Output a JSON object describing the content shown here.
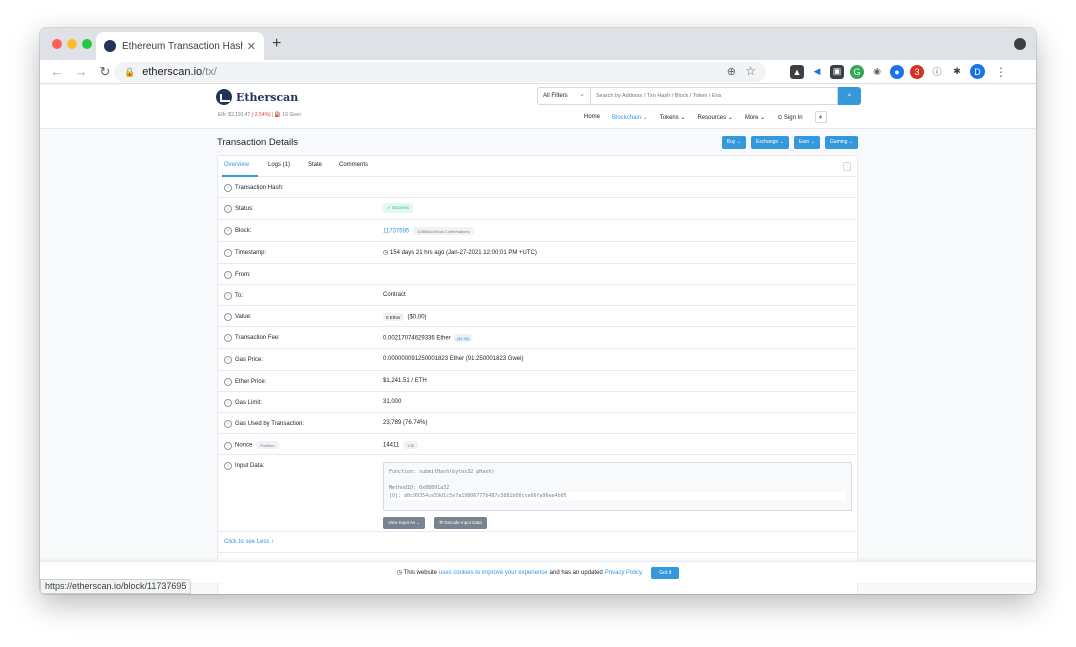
{
  "browser": {
    "tab_title": "Ethereum Transaction Hash (Tx",
    "new_tab": "+",
    "url_host": "etherscan.io",
    "url_path": "/tx/",
    "profile_initial": "D",
    "status_url": "https://etherscan.io/block/11737695"
  },
  "header": {
    "logo_text": "Etherscan",
    "eth_price_label": "Eth: $2,110.47",
    "eth_price_change": "(-2.54%)",
    "gas_label": "|  ⛽ 16 Gwei",
    "filter_label": "All Filters",
    "search_placeholder": "Search by Address / Txn Hash / Block / Token / Ens",
    "nav": [
      "Home",
      "Blockchain ⌄",
      "Tokens ⌄",
      "Resources ⌄",
      "More ⌄",
      "Sign In"
    ]
  },
  "page": {
    "title": "Transaction Details",
    "buttons": [
      "Buy ⌄",
      "Exchange ⌄",
      "Earn ⌄",
      "Gaming ⌄"
    ],
    "tabs": [
      "Overview",
      "Logs (1)",
      "State",
      "Comments"
    ]
  },
  "details": {
    "hash_label": "Transaction Hash:",
    "status_label": "Status:",
    "status_value": "Success",
    "block_label": "Block:",
    "block_value": "11737695",
    "block_confirmations": "1055884 Block Confirmations",
    "timestamp_label": "Timestamp:",
    "timestamp_value": "◷ 154 days 21 hrs ago (Jan-27-2021 12:00:01 PM +UTC)",
    "from_label": "From:",
    "to_label": "To:",
    "to_value": "Contract",
    "value_label": "Value:",
    "value_ether": "0 Ether",
    "value_usd": "($0.00)",
    "fee_label": "Transaction Fee:",
    "fee_value": "0.00217074629336 Ether",
    "fee_usd": "($4.58)",
    "gas_price_label": "Gas Price:",
    "gas_price_value": "0.000000091250001823 Ether (91.250001823 Gwei)",
    "ether_price_label": "Ether Price:",
    "ether_price_value": "$1,241.51 / ETH",
    "gas_limit_label": "Gas Limit:",
    "gas_limit_value": "31,000",
    "gas_used_label": "Gas Used by Transaction:",
    "gas_used_value": "23,789 (76.74%)",
    "nonce_label": "Nonce",
    "nonce_position_badge": "Position",
    "nonce_value": "14411",
    "nonce_position": "136",
    "input_label": "Input Data:",
    "input_function": "Function: submitHash(bytes32 pHash)",
    "input_method": "MethodID: 0x08891a32",
    "input_param": "[0]:  d0c99354ce59d1c5e7a19806777b487c3881b06cce66fa96ee4b05",
    "view_input_button": "View Input As ⌄",
    "decode_button": "⚒ Decode Input Data",
    "see_less": "Click to see Less  ↑"
  },
  "cookie": {
    "prefix": "◷ This website",
    "link1": "uses cookies to improve your experience",
    "middle": "and has an updated",
    "link2": "Privacy Policy.",
    "button": "Got it"
  }
}
